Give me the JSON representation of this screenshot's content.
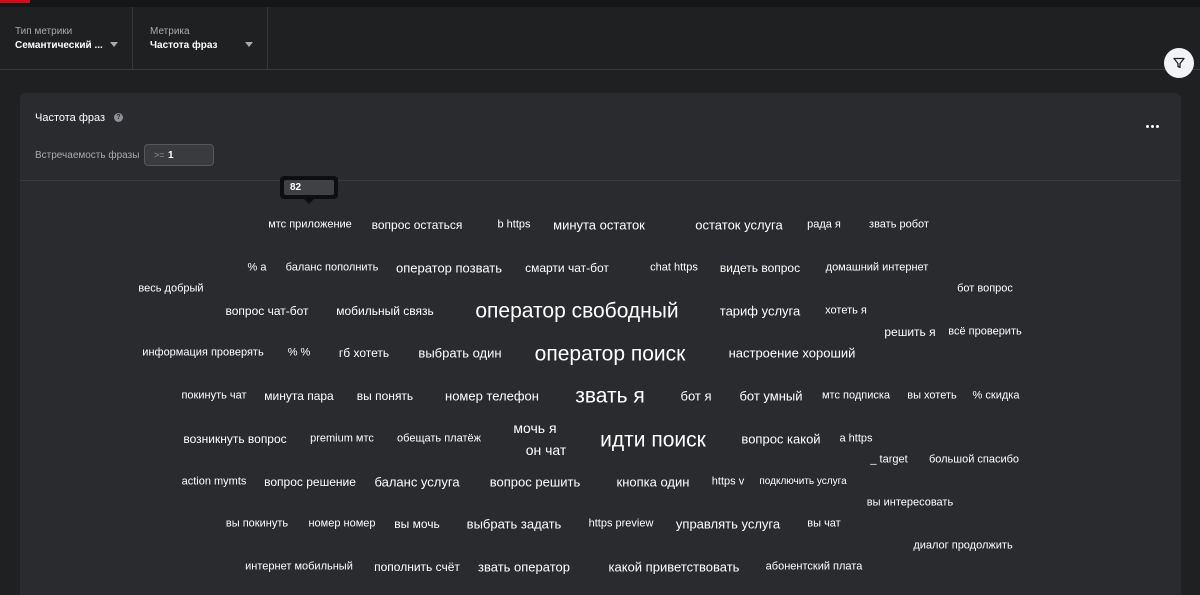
{
  "filters": [
    {
      "label": "Тип метрики",
      "value": "Семантический ..."
    },
    {
      "label": "Метрика",
      "value": "Частота фраз"
    }
  ],
  "card": {
    "title": "Частота фраз",
    "frequency_label": "Встречаемость фразы",
    "frequency_operator": ">=",
    "frequency_value": "1"
  },
  "tooltip": {
    "value": "82"
  },
  "words": [
    {
      "text": "мтс приложение",
      "size": 11
    },
    {
      "text": "вопрос остаться",
      "size": 12
    },
    {
      "text": "b https",
      "size": 11
    },
    {
      "text": "минута остаток",
      "size": 13
    },
    {
      "text": "остаток услуга",
      "size": 13
    },
    {
      "text": "рада я",
      "size": 11
    },
    {
      "text": "звать робот",
      "size": 11
    },
    {
      "text": "% а",
      "size": 11
    },
    {
      "text": "баланс пополнить",
      "size": 11
    },
    {
      "text": "оператор позвать",
      "size": 13
    },
    {
      "text": "смарти чат-бот",
      "size": 12
    },
    {
      "text": "chat https",
      "size": 11
    },
    {
      "text": "видеть вопрос",
      "size": 12
    },
    {
      "text": "домашний интернет",
      "size": 11
    },
    {
      "text": "весь добрый",
      "size": 11
    },
    {
      "text": "бот вопрос",
      "size": 11
    },
    {
      "text": "вопрос чат-бот",
      "size": 12
    },
    {
      "text": "мобильный связь",
      "size": 12
    },
    {
      "text": "оператор свободный",
      "size": 21
    },
    {
      "text": "тариф услуга",
      "size": 13
    },
    {
      "text": "хотеть я",
      "size": 11
    },
    {
      "text": "решить я",
      "size": 12
    },
    {
      "text": "всё проверить",
      "size": 11
    },
    {
      "text": "информация проверять",
      "size": 11
    },
    {
      "text": "% %",
      "size": 11
    },
    {
      "text": "гб хотеть",
      "size": 12
    },
    {
      "text": "выбрать один",
      "size": 13
    },
    {
      "text": "оператор поиск",
      "size": 21
    },
    {
      "text": "настроение хороший",
      "size": 13
    },
    {
      "text": "покинуть чат",
      "size": 11
    },
    {
      "text": "минута пара",
      "size": 12
    },
    {
      "text": "вы понять",
      "size": 12
    },
    {
      "text": "номер телефон",
      "size": 13
    },
    {
      "text": "звать я",
      "size": 21
    },
    {
      "text": "бот я",
      "size": 13
    },
    {
      "text": "бот умный",
      "size": 13
    },
    {
      "text": "мтс подписка",
      "size": 11
    },
    {
      "text": "вы хотеть",
      "size": 11
    },
    {
      "text": "% скидка",
      "size": 11
    },
    {
      "text": "возникнуть вопрос",
      "size": 12
    },
    {
      "text": "premium мтс",
      "size": 11
    },
    {
      "text": "обещать платёж",
      "size": 11
    },
    {
      "text": "мочь я",
      "size": 14
    },
    {
      "text": "он чат",
      "size": 14
    },
    {
      "text": "идти поиск",
      "size": 21
    },
    {
      "text": "вопрос какой",
      "size": 13
    },
    {
      "text": "a https",
      "size": 11
    },
    {
      "text": "_ target",
      "size": 11
    },
    {
      "text": "большой спасибо",
      "size": 11
    },
    {
      "text": "action mymts",
      "size": 11
    },
    {
      "text": "вопрос решение",
      "size": 12
    },
    {
      "text": "баланс услуга",
      "size": 13
    },
    {
      "text": "вопрос решить",
      "size": 13
    },
    {
      "text": "кнопка один",
      "size": 13
    },
    {
      "text": "https v",
      "size": 11
    },
    {
      "text": "подключить услуга",
      "size": 10
    },
    {
      "text": "вы интересовать",
      "size": 11
    },
    {
      "text": "вы покинуть",
      "size": 11
    },
    {
      "text": "номер номер",
      "size": 11
    },
    {
      "text": "вы мочь",
      "size": 12
    },
    {
      "text": "выбрать задать",
      "size": 13
    },
    {
      "text": "https preview",
      "size": 11
    },
    {
      "text": "управлять услуга",
      "size": 13
    },
    {
      "text": "вы чат",
      "size": 11
    },
    {
      "text": "диалог продолжить",
      "size": 11
    },
    {
      "text": "интернет мобильный",
      "size": 11
    },
    {
      "text": "пополнить счёт",
      "size": 12
    },
    {
      "text": "звать оператор",
      "size": 13
    },
    {
      "text": "какой приветствовать",
      "size": 13
    },
    {
      "text": "абонентский плата",
      "size": 11
    }
  ]
}
